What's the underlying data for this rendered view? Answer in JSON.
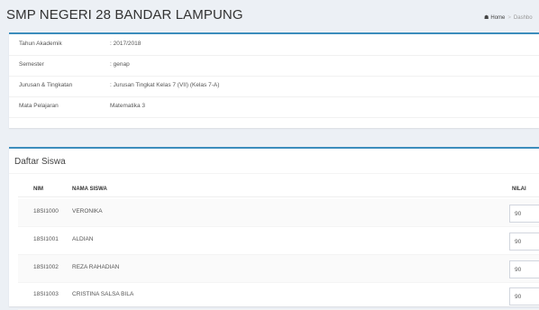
{
  "header": {
    "title": "SMP NEGERI 28 BANDAR LAMPUNG",
    "breadcrumb": [
      "Home",
      "Dashbo"
    ]
  },
  "info": [
    {
      "label": "Tahun Akademik",
      "value": ": 2017/2018"
    },
    {
      "label": "Semester",
      "value": ": genap"
    },
    {
      "label": "Jurusan & Tingkatan",
      "value": ": Jurusan Tingkat Kelas 7 (VII) (Kelas 7-A)"
    },
    {
      "label": "Mata Pelajaran",
      "value": "Matematika 3"
    }
  ],
  "list": {
    "title": "Daftar Siswa",
    "columns": {
      "nim": "NIM",
      "nama": "NAMA SISWA",
      "nilai": "NILAI"
    },
    "rows": [
      {
        "nim": "18SI1000",
        "nama": "VERONIKA",
        "nilai": "90"
      },
      {
        "nim": "18SI1001",
        "nama": "ALDIAN",
        "nilai": "90"
      },
      {
        "nim": "18SI1002",
        "nama": "REZA RAHADIAN",
        "nilai": "90"
      },
      {
        "nim": "18SI1003",
        "nama": "CRISTINA SALSA BILA",
        "nilai": "90"
      }
    ]
  },
  "colors": {
    "accent": "#3c8dbc",
    "background": "#ecf0f5"
  },
  "icons": {
    "home": "home-icon"
  }
}
